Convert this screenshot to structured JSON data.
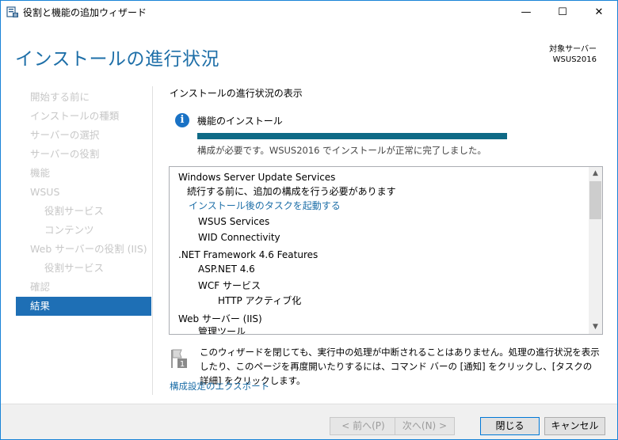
{
  "window": {
    "title": "役割と機能の追加ウィザード",
    "controls": {
      "minimize": "—",
      "maximize": "☐",
      "close": "✕"
    }
  },
  "header": {
    "title": "インストールの進行状況",
    "target_label": "対象サーバー",
    "target_server": "WSUS2016"
  },
  "nav": {
    "items": [
      {
        "label": "開始する前に",
        "level": 0,
        "active": false
      },
      {
        "label": "インストールの種類",
        "level": 0,
        "active": false
      },
      {
        "label": "サーバーの選択",
        "level": 0,
        "active": false
      },
      {
        "label": "サーバーの役割",
        "level": 0,
        "active": false
      },
      {
        "label": "機能",
        "level": 0,
        "active": false
      },
      {
        "label": "WSUS",
        "level": 0,
        "active": false
      },
      {
        "label": "役割サービス",
        "level": 1,
        "active": false
      },
      {
        "label": "コンテンツ",
        "level": 1,
        "active": false
      },
      {
        "label": "Web サーバーの役割 (IIS)",
        "level": 0,
        "active": false
      },
      {
        "label": "役割サービス",
        "level": 1,
        "active": false
      },
      {
        "label": "確認",
        "level": 0,
        "active": false
      },
      {
        "label": "結果",
        "level": 0,
        "active": true
      }
    ]
  },
  "main": {
    "section_title": "インストールの進行状況の表示",
    "feature_title": "機能のインストール",
    "progress": 1.0,
    "progress_message": "構成が必要です。WSUS2016 でインストールが正常に完了しました。",
    "results": [
      {
        "text": "Windows Server Update Services",
        "type": "heading"
      },
      {
        "text": "続行する前に、追加の構成を行う必要があります",
        "type": "text"
      },
      {
        "text": "インストール後のタスクを起動する",
        "type": "link"
      },
      {
        "text": "WSUS Services",
        "type": "text"
      },
      {
        "text": "WID Connectivity",
        "type": "text"
      },
      {
        "text": ".NET Framework 4.6 Features",
        "type": "heading"
      },
      {
        "text": "ASP.NET 4.6",
        "type": "text"
      },
      {
        "text": "WCF サービス",
        "type": "text"
      },
      {
        "text": "HTTP アクティブ化",
        "type": "text"
      },
      {
        "text": "Web サーバー (IIS)",
        "type": "heading"
      },
      {
        "text": "管理ツール",
        "type": "text"
      }
    ],
    "note_text": "このウィザードを閉じても、実行中の処理が中断されることはありません。処理の進行状況を表示したり、このページを再度開いたりするには、コマンド バーの [通知] をクリックし、[タスクの詳細] をクリックします。",
    "note_badge": "1",
    "export_link": "構成設定のエクスポート"
  },
  "footer": {
    "prev": "< 前へ(P)",
    "next": "次へ(N) >",
    "close": "閉じる",
    "cancel": "キャンセル"
  }
}
